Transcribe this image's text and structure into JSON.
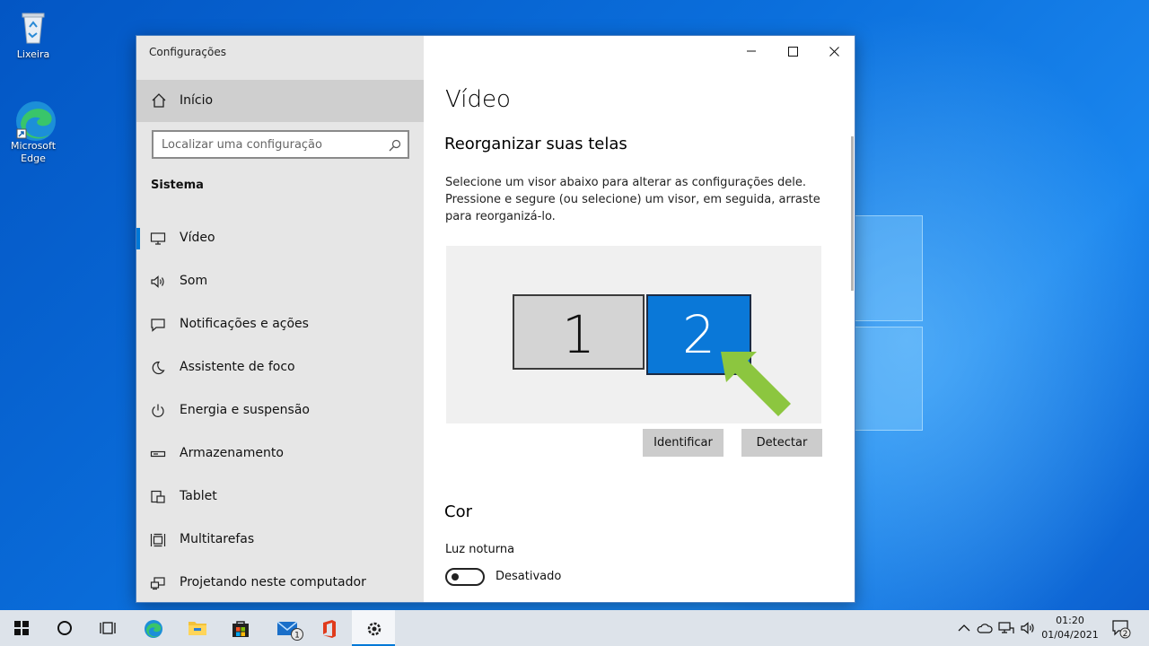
{
  "desktop": {
    "icons": [
      {
        "label": "Lixeira"
      },
      {
        "label": "Microsoft Edge"
      }
    ]
  },
  "window": {
    "title": "Configurações",
    "controls": {
      "minimize": "minimize",
      "maximize": "maximize",
      "close": "close"
    }
  },
  "sidebar": {
    "home": "Início",
    "search_placeholder": "Localizar uma configuração",
    "section": "Sistema",
    "items": [
      {
        "label": "Vídeo",
        "icon": "monitor-icon",
        "active": true
      },
      {
        "label": "Som",
        "icon": "speaker-icon"
      },
      {
        "label": "Notificações e ações",
        "icon": "notification-icon"
      },
      {
        "label": "Assistente de foco",
        "icon": "moon-icon"
      },
      {
        "label": "Energia e suspensão",
        "icon": "power-icon"
      },
      {
        "label": "Armazenamento",
        "icon": "storage-icon"
      },
      {
        "label": "Tablet",
        "icon": "tablet-icon"
      },
      {
        "label": "Multitarefas",
        "icon": "multitask-icon"
      },
      {
        "label": "Projetando neste computador",
        "icon": "project-icon"
      }
    ]
  },
  "content": {
    "title": "Vídeo",
    "arrange_title": "Reorganizar suas telas",
    "description": "Selecione um visor abaixo para alterar as configurações dele. Pressione e segure (ou selecione) um visor, em seguida, arraste para reorganizá-lo.",
    "monitors": [
      "1",
      "2"
    ],
    "identify_button": "Identificar",
    "detect_button": "Detectar",
    "color_title": "Cor",
    "night_light_label": "Luz noturna",
    "night_light_state": "Desativado"
  },
  "taskbar": {
    "mail_badge": "1",
    "time": "01:20",
    "date": "01/04/2021",
    "notification_count": "2"
  },
  "colors": {
    "accent": "#0078d7",
    "selected_monitor": "#0a78d8",
    "arrow": "#8cc63f"
  }
}
